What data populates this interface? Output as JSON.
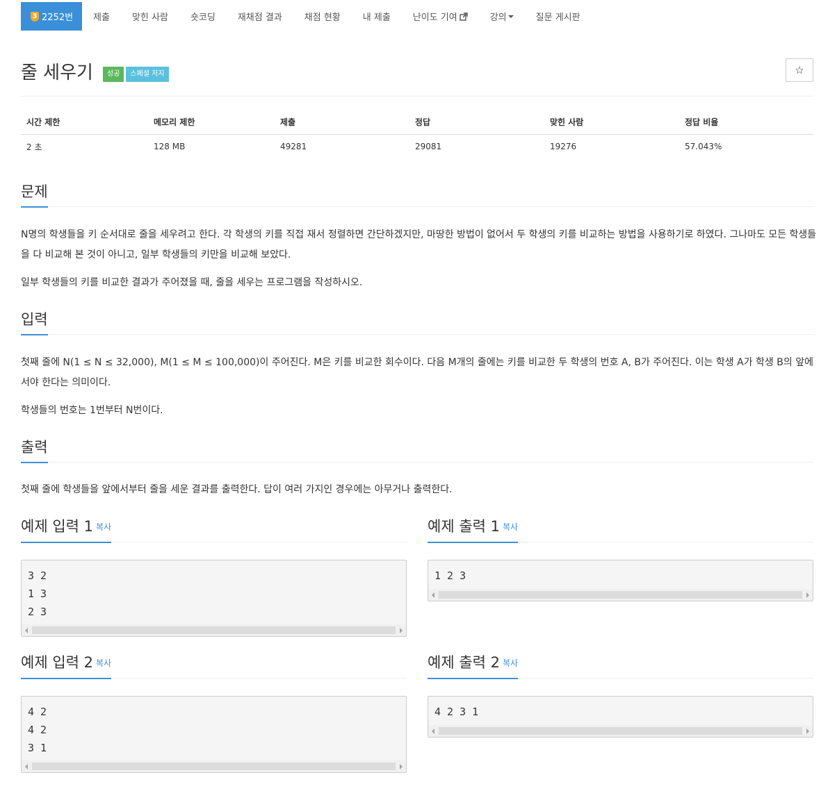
{
  "nav": {
    "problem_number": "2252번",
    "tier_digit": "3",
    "items": [
      "제출",
      "맞힌 사람",
      "숏코딩",
      "재채점 결과",
      "채점 현황",
      "내 제출",
      "난이도 기여",
      "강의"
    ],
    "last_item": "질문 게시판"
  },
  "title": "줄 세우기",
  "labels": [
    "성공",
    "스페셜 저지"
  ],
  "star_icon": "☆",
  "info_table": {
    "headers": [
      "시간 제한",
      "메모리 제한",
      "제출",
      "정답",
      "맞힌 사람",
      "정답 비율"
    ],
    "values": [
      "2 초",
      "128 MB",
      "49281",
      "29081",
      "19276",
      "57.043%"
    ]
  },
  "sections": {
    "problem": {
      "title": "문제",
      "p1": "N명의 학생들을 키 순서대로 줄을 세우려고 한다. 각 학생의 키를 직접 재서 정렬하면 간단하겠지만, 마땅한 방법이 없어서 두 학생의 키를 비교하는 방법을 사용하기로 하였다. 그나마도 모든 학생들을 다 비교해 본 것이 아니고, 일부 학생들의 키만을 비교해 보았다.",
      "p2": "일부 학생들의 키를 비교한 결과가 주어졌을 때, 줄을 세우는 프로그램을 작성하시오."
    },
    "input": {
      "title": "입력",
      "p1": "첫째 줄에 N(1 ≤ N ≤ 32,000), M(1 ≤ M ≤ 100,000)이 주어진다. M은 키를 비교한 회수이다. 다음 M개의 줄에는 키를 비교한 두 학생의 번호 A, B가 주어진다. 이는 학생 A가 학생 B의 앞에 서야 한다는 의미이다.",
      "p2": "학생들의 번호는 1번부터 N번이다."
    },
    "output": {
      "title": "출력",
      "p1": "첫째 줄에 학생들을 앞에서부터 줄을 세운 결과를 출력한다. 답이 여러 가지인 경우에는 아무거나 출력한다."
    }
  },
  "copy_label": "복사",
  "samples": {
    "input1": {
      "title": "예제 입력 1",
      "content": "3 2\n1 3\n2 3"
    },
    "output1": {
      "title": "예제 출력 1",
      "content": "1 2 3"
    },
    "input2": {
      "title": "예제 입력 2",
      "content": "4 2\n4 2\n3 1"
    },
    "output2": {
      "title": "예제 출력 2",
      "content": "4 2 3 1"
    }
  }
}
